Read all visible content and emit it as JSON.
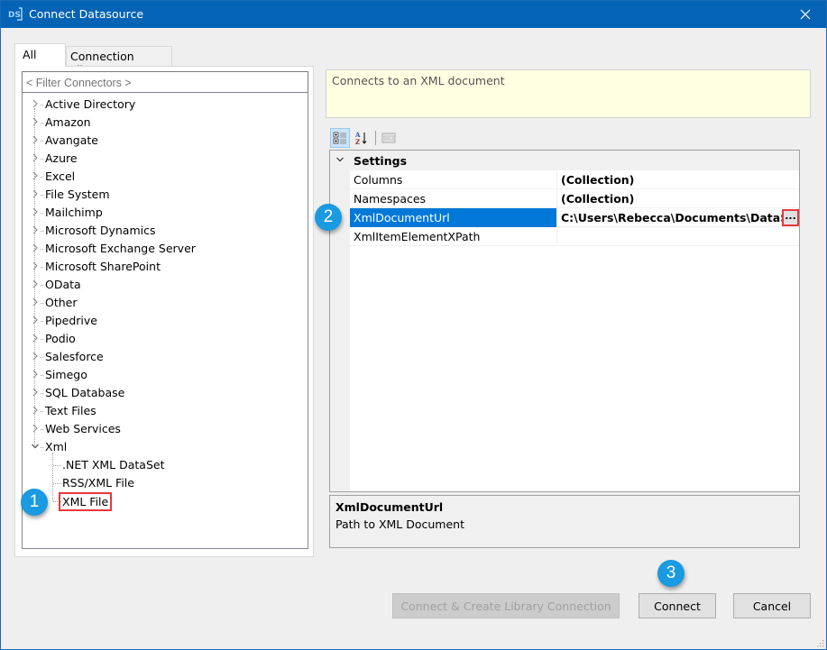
{
  "window": {
    "title": "Connect Datasource",
    "app_icon": "datasync-logo-icon",
    "close_icon": "close-icon"
  },
  "tabs": [
    {
      "label": "All",
      "active": true
    },
    {
      "label": "Connection Library",
      "active": false
    }
  ],
  "filter": {
    "placeholder": "< Filter Connectors >"
  },
  "tree": {
    "items": [
      {
        "label": "Active Directory",
        "expanded": false
      },
      {
        "label": "Amazon",
        "expanded": false
      },
      {
        "label": "Avangate",
        "expanded": false
      },
      {
        "label": "Azure",
        "expanded": false
      },
      {
        "label": "Excel",
        "expanded": false
      },
      {
        "label": "File System",
        "expanded": false
      },
      {
        "label": "Mailchimp",
        "expanded": false
      },
      {
        "label": "Microsoft Dynamics",
        "expanded": false
      },
      {
        "label": "Microsoft Exchange Server",
        "expanded": false
      },
      {
        "label": "Microsoft SharePoint",
        "expanded": false
      },
      {
        "label": "OData",
        "expanded": false
      },
      {
        "label": "Other",
        "expanded": false
      },
      {
        "label": "Pipedrive",
        "expanded": false
      },
      {
        "label": "Podio",
        "expanded": false
      },
      {
        "label": "Salesforce",
        "expanded": false
      },
      {
        "label": "Simego",
        "expanded": false
      },
      {
        "label": "SQL Database",
        "expanded": false
      },
      {
        "label": "Text Files",
        "expanded": false
      },
      {
        "label": "Web Services",
        "expanded": false
      },
      {
        "label": "Xml",
        "expanded": true
      }
    ],
    "xml_children": [
      {
        "label": ".NET XML DataSet"
      },
      {
        "label": "RSS/XML File"
      },
      {
        "label": "XML File",
        "highlighted": true
      }
    ]
  },
  "badges": {
    "step1": "1",
    "step2": "2",
    "step3": "3"
  },
  "description": "Connects to an XML document",
  "toolbar": {
    "categorized_icon": "categorized-view-icon",
    "alphabetical_icon": "sort-alphabetical-icon",
    "property_pages_icon": "property-pages-icon"
  },
  "property_grid": {
    "category": "Settings",
    "rows": [
      {
        "name": "Columns",
        "value": "(Collection)"
      },
      {
        "name": "Namespaces",
        "value": "(Collection)"
      },
      {
        "name": "XmlDocumentUrl",
        "value": "C:\\Users\\Rebecca\\Documents\\DataSync",
        "selected": true
      },
      {
        "name": "XmlItemElementXPath",
        "value": ""
      }
    ],
    "ellipsis_label": "..."
  },
  "help": {
    "title": "XmlDocumentUrl",
    "text": "Path to XML Document"
  },
  "buttons": {
    "connect_create": "Connect & Create Library Connection",
    "connect": "Connect",
    "cancel": "Cancel"
  },
  "colors": {
    "titlebar": "#0563b6",
    "selection": "#0078d7",
    "badge": "#1a9ae0",
    "highlight_box": "#e8383d",
    "description_bg": "#ffffe1"
  }
}
